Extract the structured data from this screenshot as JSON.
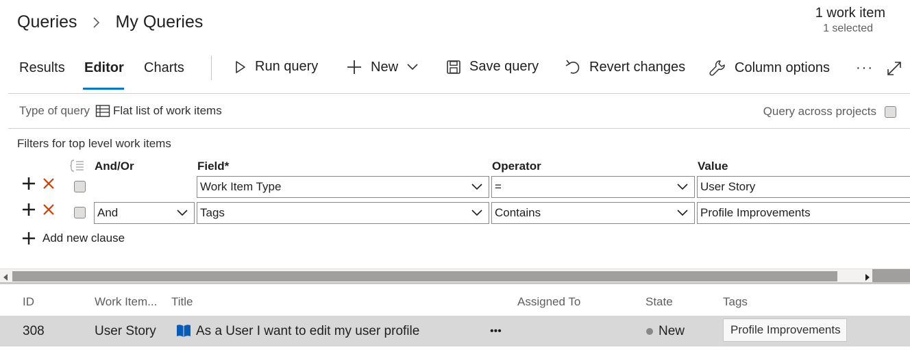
{
  "breadcrumb": {
    "root": "Queries",
    "current": "My Queries"
  },
  "summary": {
    "count": "1 work item",
    "selected": "1 selected"
  },
  "tabs": {
    "results": "Results",
    "editor": "Editor",
    "charts": "Charts"
  },
  "toolbar": {
    "run_query": "Run query",
    "new": "New",
    "save_query": "Save query",
    "revert_changes": "Revert changes",
    "column_options": "Column options",
    "more": "···"
  },
  "query_type": {
    "label": "Type of query",
    "value": "Flat list of work items",
    "across_projects": "Query across projects"
  },
  "filters": {
    "title": "Filters for top level work items",
    "headers": {
      "and_or": "And/Or",
      "field": "Field*",
      "operator": "Operator",
      "value": "Value"
    },
    "rows": [
      {
        "and_or": "",
        "field": "Work Item Type",
        "operator": "=",
        "value": "User Story"
      },
      {
        "and_or": "And",
        "field": "Tags",
        "operator": "Contains",
        "value": "Profile Improvements"
      }
    ],
    "add_clause": "Add new clause"
  },
  "grid": {
    "headers": {
      "id": "ID",
      "type": "Work Item...",
      "title": "Title",
      "assigned_to": "Assigned To",
      "state": "State",
      "tags": "Tags"
    },
    "rows": [
      {
        "id": "308",
        "type": "User Story",
        "title": "As a User I want to edit my user profile",
        "more": "•••",
        "state": "New",
        "tags": "Profile Improvements"
      }
    ]
  },
  "colors": {
    "accent": "#0078d4",
    "delete": "#d83b01",
    "story_icon": "#0a5bb5",
    "selected_row": "#d8d8d8"
  }
}
